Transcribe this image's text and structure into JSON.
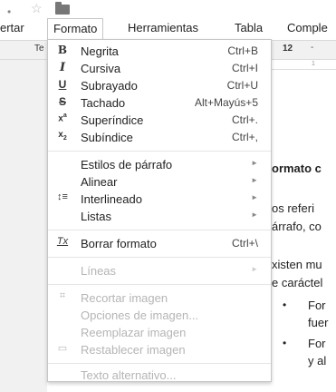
{
  "top_icons": {
    "dot": "•",
    "star": "☆"
  },
  "menubar": {
    "items": [
      {
        "label": "ertar"
      },
      {
        "label": "Formato"
      },
      {
        "label": "Herramientas"
      },
      {
        "label": "Tabla"
      },
      {
        "label": "Comple"
      }
    ]
  },
  "toolbar": {
    "font_label": "Te",
    "size": "12",
    "minus": "-"
  },
  "ruler": {
    "mark": "1"
  },
  "document": {
    "lines": [
      {
        "text": "ormato c",
        "heading": true
      },
      {
        "text": "os referi",
        "heading": false
      },
      {
        "text": "árrafo, co",
        "heading": false
      },
      {
        "text": "xisten mu",
        "heading": false
      },
      {
        "text": "e caráctel",
        "heading": false
      },
      {
        "text": "For",
        "heading": false
      },
      {
        "text": "fuer",
        "heading": false
      },
      {
        "text": "For",
        "heading": false
      },
      {
        "text": "y al",
        "heading": false
      }
    ],
    "bullet": "•"
  },
  "format_menu": {
    "items": [
      {
        "icon": "bold-icon",
        "glyph": "B",
        "label": "Negrita",
        "shortcut": "Ctrl+B",
        "disabled": false
      },
      {
        "icon": "italic-icon",
        "glyph": "I",
        "label": "Cursiva",
        "shortcut": "Ctrl+I",
        "disabled": false
      },
      {
        "icon": "underline-icon",
        "glyph": "U",
        "label": "Subrayado",
        "shortcut": "Ctrl+U",
        "disabled": false
      },
      {
        "icon": "strikethrough-icon",
        "glyph": "S",
        "label": "Tachado",
        "shortcut": "Alt+Mayús+5",
        "disabled": false
      },
      {
        "icon": "superscript-icon",
        "glyph": "x",
        "label": "Superíndice",
        "shortcut": "Ctrl+.",
        "disabled": false
      },
      {
        "icon": "subscript-icon",
        "glyph": "x",
        "label": "Subíndice",
        "shortcut": "Ctrl+,",
        "disabled": false
      },
      {
        "icon": "",
        "label": "Estilos de párrafo",
        "submenu": true,
        "disabled": false
      },
      {
        "icon": "",
        "label": "Alinear",
        "submenu": true,
        "disabled": false
      },
      {
        "icon": "line-spacing-icon",
        "glyph": "↕≡",
        "label": "Interlineado",
        "submenu": true,
        "disabled": false
      },
      {
        "icon": "",
        "label": "Listas",
        "submenu": true,
        "disabled": false
      },
      {
        "icon": "clear-formatting-icon",
        "glyph": "Tx",
        "label": "Borrar formato",
        "shortcut": "Ctrl+\\",
        "disabled": false
      },
      {
        "icon": "",
        "label": "Líneas",
        "submenu": true,
        "disabled": true
      },
      {
        "icon": "crop-icon",
        "glyph": "⌗",
        "label": "Recortar imagen",
        "disabled": true
      },
      {
        "icon": "",
        "label": "Opciones de imagen...",
        "disabled": true
      },
      {
        "icon": "",
        "label": "Reemplazar imagen",
        "disabled": true
      },
      {
        "icon": "reset-image-icon",
        "glyph": "▭",
        "label": "Restablecer imagen",
        "disabled": true
      },
      {
        "icon": "",
        "label": "Texto alternativo...",
        "disabled": true
      }
    ],
    "submenu_arrow": "►"
  }
}
